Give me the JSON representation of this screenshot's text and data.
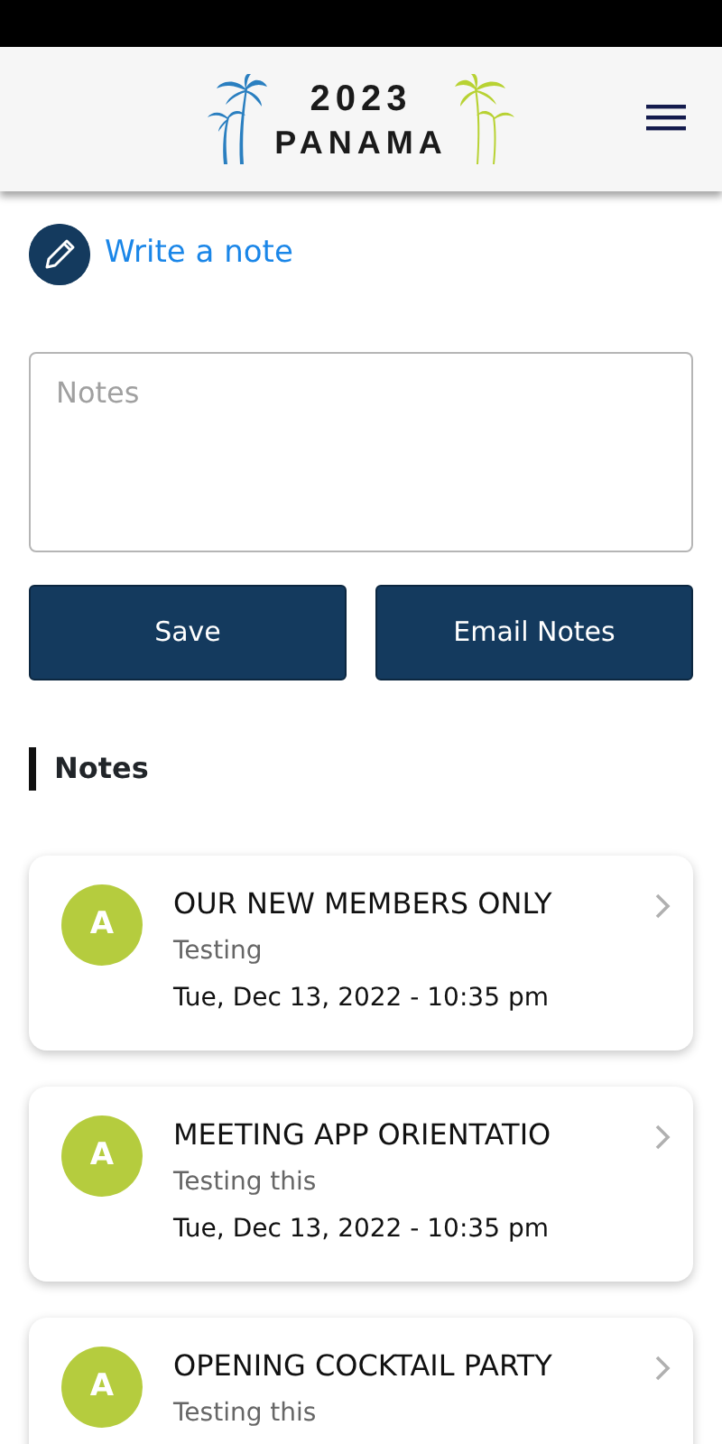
{
  "header": {
    "logo_year": "2023",
    "logo_name": "PANAMA"
  },
  "write_note": {
    "label": "Write a note"
  },
  "notes_field": {
    "placeholder": "Notes"
  },
  "buttons": [
    {
      "label": "Save"
    },
    {
      "label": "Email Notes"
    }
  ],
  "section_title": "Notes",
  "notes": [
    {
      "avatar": "A",
      "title": "OUR NEW MEMBERS ONLY",
      "subtitle": "Testing",
      "date": "Tue, Dec 13, 2022 - 10:35 pm"
    },
    {
      "avatar": "A",
      "title": "MEETING APP ORIENTATIO",
      "subtitle": "Testing this",
      "date": "Tue, Dec 13, 2022 - 10:35 pm"
    },
    {
      "avatar": "A",
      "title": "OPENING COCKTAIL PARTY",
      "subtitle": "Testing this"
    }
  ]
}
